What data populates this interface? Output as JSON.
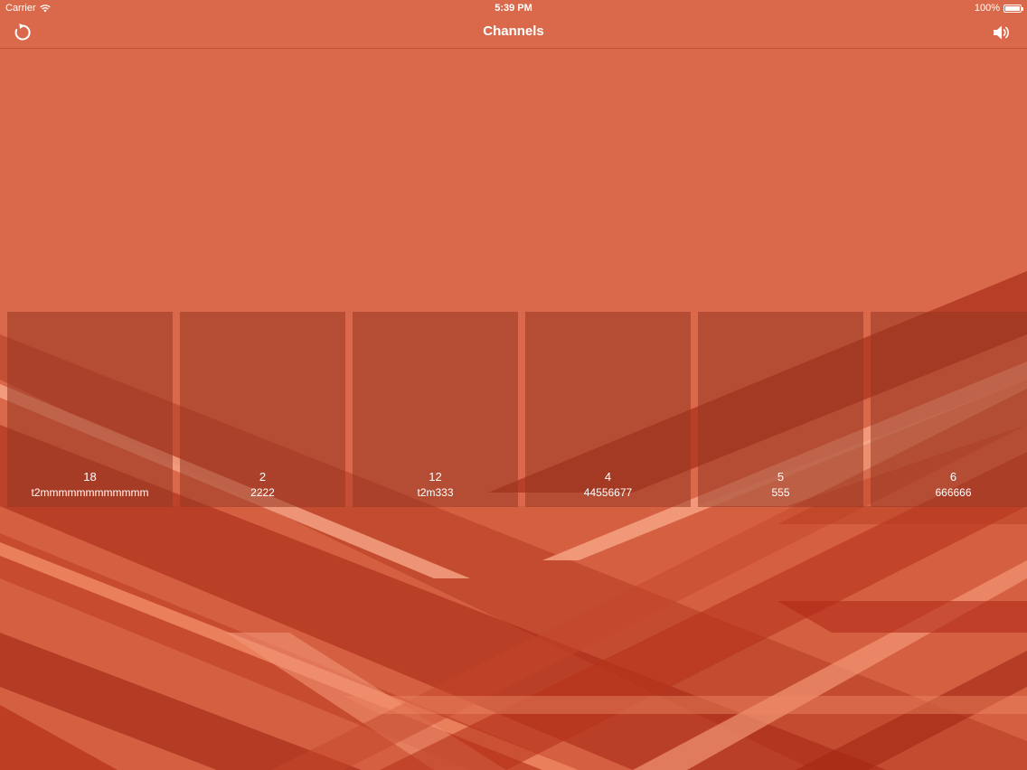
{
  "status_bar": {
    "carrier": "Carrier",
    "time": "5:39 PM",
    "battery": "100%",
    "battery_level": 1.0
  },
  "nav": {
    "title": "Channels",
    "left_icon": "refresh-icon",
    "right_icon": "speaker-icon"
  },
  "colors": {
    "background": "#d9694a",
    "stripe_dark": "#b02a18",
    "stripe_light": "#f39070",
    "tile": "#a84f35"
  },
  "channels": [
    {
      "number": "18",
      "name": "t2mmmmmmmmmmmm"
    },
    {
      "number": "2",
      "name": "2222"
    },
    {
      "number": "12",
      "name": "t2m333"
    },
    {
      "number": "4",
      "name": "44556677"
    },
    {
      "number": "5",
      "name": "555"
    },
    {
      "number": "6",
      "name": "666666"
    }
  ]
}
